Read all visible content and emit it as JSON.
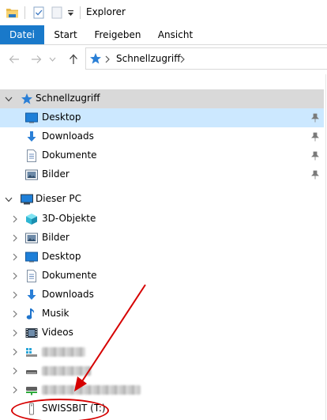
{
  "window": {
    "title": "Explorer"
  },
  "quick_access": {
    "icons": [
      "folder-icon",
      "properties-icon",
      "new-folder-icon",
      "customize-dropdown-icon"
    ]
  },
  "ribbon": {
    "tabs": [
      {
        "label": "Datei",
        "active": true
      },
      {
        "label": "Start"
      },
      {
        "label": "Freigeben"
      },
      {
        "label": "Ansicht"
      }
    ]
  },
  "address": {
    "path": "Schnellzugriff",
    "icons": [
      "back-arrow-icon",
      "forward-arrow-icon",
      "recent-dropdown-icon",
      "up-arrow-icon",
      "star-icon",
      "chevron-right-icon"
    ]
  },
  "tree": {
    "quick_access": {
      "label": "Schnellzugriff",
      "items": [
        {
          "label": "Desktop",
          "icon": "desktop-icon",
          "pinned": true,
          "selected": true
        },
        {
          "label": "Downloads",
          "icon": "download-icon",
          "pinned": true
        },
        {
          "label": "Dokumente",
          "icon": "document-icon",
          "pinned": true
        },
        {
          "label": "Bilder",
          "icon": "pictures-icon",
          "pinned": true
        }
      ]
    },
    "this_pc": {
      "label": "Dieser PC",
      "items": [
        {
          "label": "3D-Objekte",
          "icon": "3d-objects-icon"
        },
        {
          "label": "Bilder",
          "icon": "pictures-icon"
        },
        {
          "label": "Desktop",
          "icon": "desktop-icon"
        },
        {
          "label": "Dokumente",
          "icon": "document-icon"
        },
        {
          "label": "Downloads",
          "icon": "download-icon"
        },
        {
          "label": "Musik",
          "icon": "music-icon"
        },
        {
          "label": "Videos",
          "icon": "video-icon"
        }
      ],
      "drives": [
        {
          "icon": "drive-icon"
        },
        {
          "icon": "drive-icon"
        },
        {
          "icon": "network-drive-icon"
        },
        {
          "label": "SWISSBIT (T:)",
          "icon": "usb-drive-icon"
        }
      ]
    }
  },
  "colors": {
    "file_tab": "#1979ca",
    "selected_row": "#cce8ff",
    "header_row": "#d9d9d9",
    "annotation": "#d60000"
  }
}
